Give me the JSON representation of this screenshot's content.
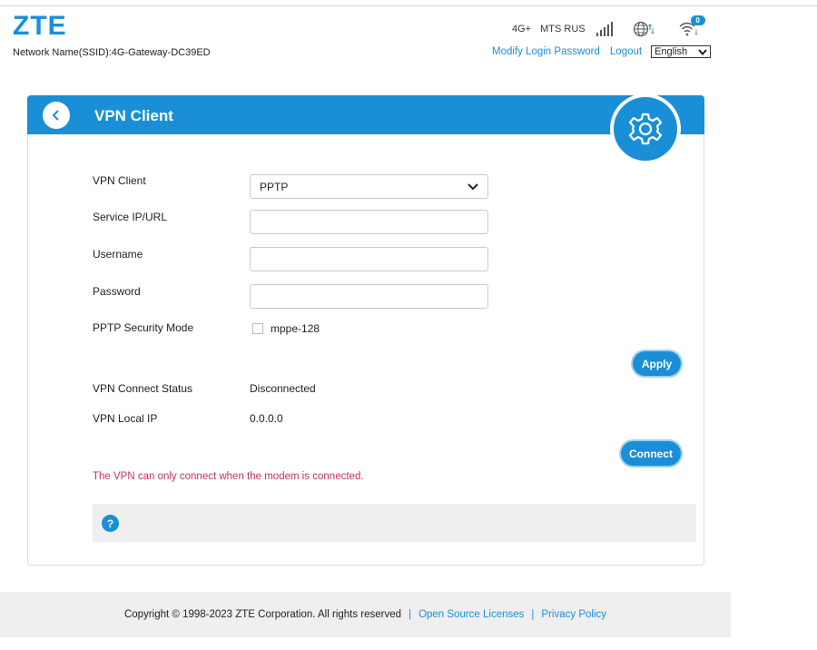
{
  "brand": {
    "logo": "ZTE",
    "ssid": "Network Name(SSID):4G-Gateway-DC39ED"
  },
  "status": {
    "network_type": "4G+",
    "carrier": "MTS RUS",
    "wifi_clients": "0"
  },
  "header_links": {
    "modify_password": "Modify Login Password",
    "logout": "Logout",
    "language": "English"
  },
  "card": {
    "title": "VPN Client",
    "fields": {
      "vpn_client": {
        "label": "VPN Client",
        "value": "PPTP"
      },
      "service_ip": {
        "label": "Service IP/URL",
        "value": "",
        "placeholder": ""
      },
      "username": {
        "label": "Username",
        "value": "",
        "placeholder": ""
      },
      "password": {
        "label": "Password",
        "value": "",
        "placeholder": ""
      },
      "security_mode": {
        "label": "PPTP Security Mode",
        "option": "mppe-128",
        "checked": false
      }
    },
    "apply_label": "Apply",
    "connect_status": {
      "label": "VPN Connect Status",
      "value": "Disconnected"
    },
    "local_ip": {
      "label": "VPN Local IP",
      "value": "0.0.0.0"
    },
    "connect_label": "Connect",
    "warning": "The VPN can only connect when the modem is connected."
  },
  "footer": {
    "copyright": "Copyright © 1998-2023 ZTE Corporation. All rights reserved",
    "open_source": "Open Source Licenses",
    "privacy": "Privacy Policy"
  },
  "colors": {
    "accent": "#1a8fd8",
    "warning": "#c0325b"
  }
}
